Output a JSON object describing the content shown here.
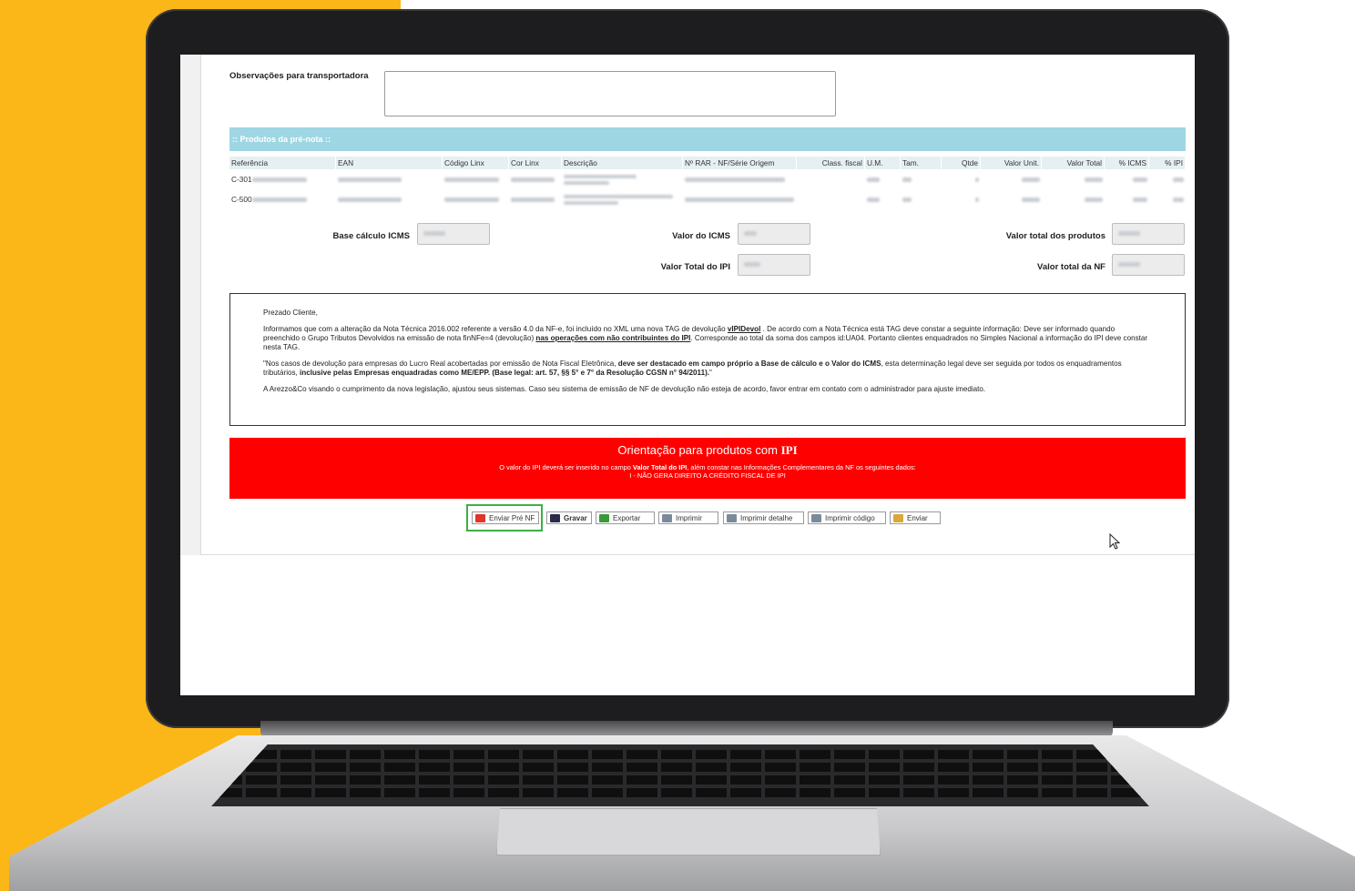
{
  "form": {
    "obs_label": "Observações para transportadora",
    "obs_value": ""
  },
  "products": {
    "section_title": ":: Produtos da pré-nota ::",
    "columns": [
      "Referência",
      "EAN",
      "Código Linx",
      "Cor Linx",
      "Descrição",
      "Nº RAR - NF/Série Origem",
      "Class. fiscal",
      "U.M.",
      "Tam.",
      "Qtde",
      "Valor Unit.",
      "Valor Total",
      "% ICMS",
      "% IPI"
    ],
    "rows": [
      {
        "ref_prefix": "C-301"
      },
      {
        "ref_prefix": "C-500"
      }
    ]
  },
  "totals": {
    "base_icms_label": "Base cálculo ICMS",
    "valor_icms_label": "Valor do ICMS",
    "valor_total_produtos_label": "Valor total dos produtos",
    "valor_total_ipi_label": "Valor Total do IPI",
    "valor_total_nf_label": "Valor total da NF"
  },
  "notice": {
    "greeting": "Prezado Cliente,",
    "p1_a": "Informamos que com a alteração da Nota Técnica 2016.002 referente a versão 4.0 da NF-e, foi incluído no XML uma nova TAG de devolução ",
    "p1_tag": "vIPIDevol",
    "p1_b": " . De acordo com a Nota Técnica está TAG deve constar a seguinte informação: Deve ser informado quando preenchido o Grupo Tributos Devolvidos na emissão de nota finNFe=4 (devolução) ",
    "p1_u": "nas operações com não contribuintes do IPI",
    "p1_c": ". Corresponde ao total da soma dos campos id:UA04. Portanto clientes enquadrados no Simples Nacional a informação do IPI deve constar nesta TAG.",
    "p2_a": "\"Nos casos de devolução para empresas do Lucro Real acobertadas por emissão de Nota Fiscal Eletrônica, ",
    "p2_b": "deve ser destacado em campo próprio a Base de cálculo e o Valor do ICMS",
    "p2_c": ", esta determinação legal deve ser seguida por todos os enquadramentos tributários, ",
    "p2_d": "inclusive pelas Empresas enquadradas como ME/EPP. (Base legal: art. 57, §§ 5° e 7° da Resolução CGSN n° 94/2011).",
    "p2_e": "\"",
    "p3": "A Arezzo&Co visando o cumprimento da nova legislação, ajustou seus sistemas. Caso seu sistema de emissão de NF de devolução não esteja de acordo, favor entrar em contato com o administrador para ajuste imediato."
  },
  "ipi_box": {
    "title_a": "Orientação para produtos com ",
    "title_b": "IPI",
    "line_a": "O valor do IPI deverá ser inserido no campo ",
    "line_b": "Valor Total do IPI",
    "line_c": ", além constar nas Informações Complementares da NF os seguintes dados:",
    "line2": "I - NÃO GERA DIREITO A CRÉDITO FISCAL DE IPI"
  },
  "buttons": {
    "enviar_pre_nf": "Enviar Pré NF",
    "gravar": "Gravar",
    "exportar": "Exportar",
    "imprimir": "Imprimir",
    "imprimir_detalhe": "Imprimir detalhe",
    "imprimir_codigo": "Imprimir código",
    "enviar": "Enviar"
  },
  "colors": {
    "background_accent": "#fbb617",
    "section_bar": "#9fd6e3",
    "ipi_box": "#ff0000",
    "highlight": "#3cb043"
  }
}
